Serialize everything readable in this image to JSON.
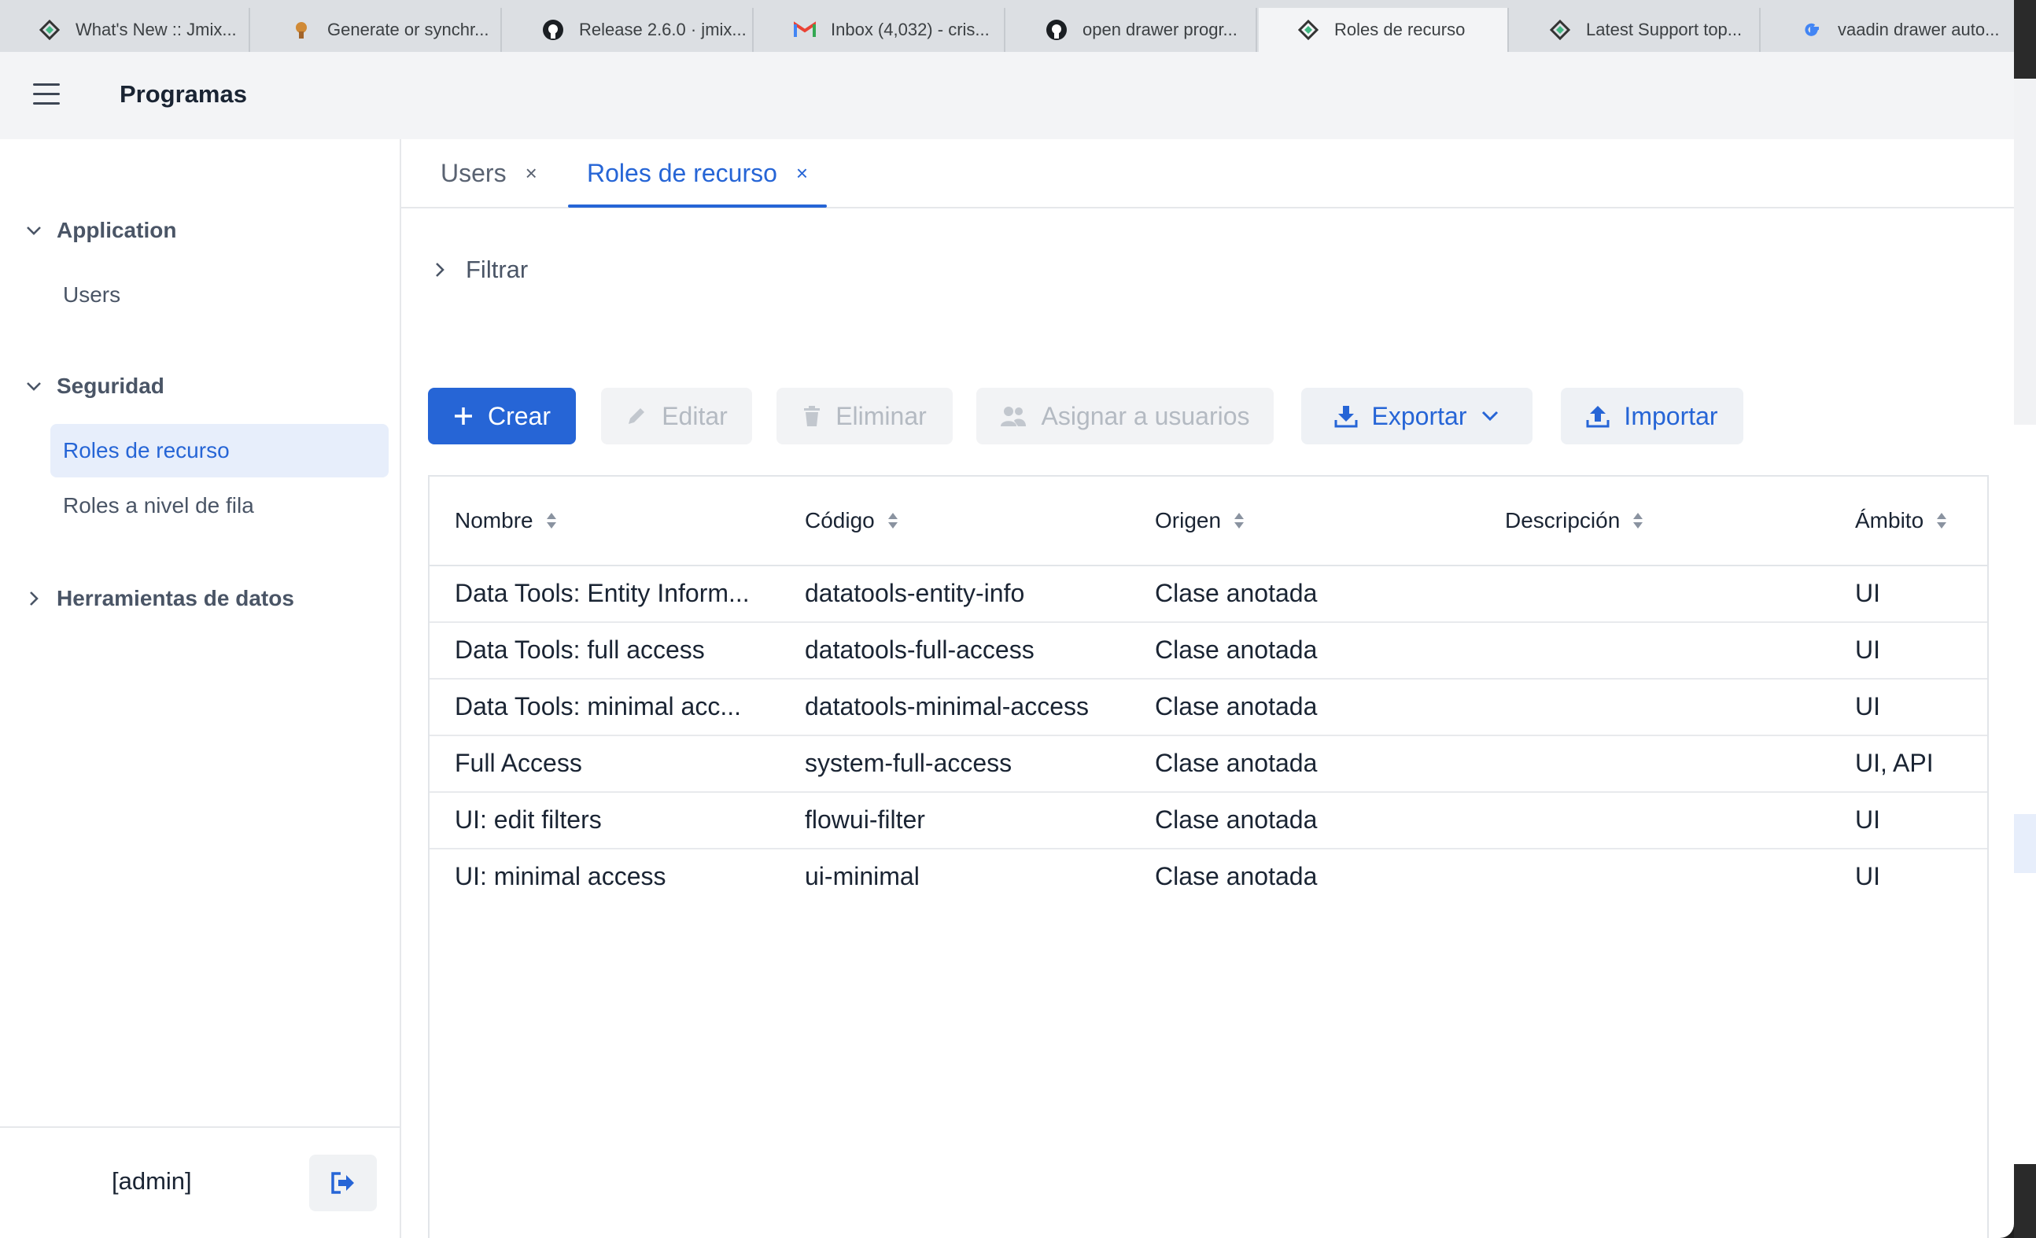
{
  "browser_tabs": [
    {
      "label": "What's New :: Jmix...",
      "icon": "jmix-icon"
    },
    {
      "label": "Generate or synchr...",
      "icon": "tool-icon"
    },
    {
      "label": "Release 2.6.0 · jmix...",
      "icon": "github-icon"
    },
    {
      "label": "Inbox (4,032) - cris...",
      "icon": "gmail-icon"
    },
    {
      "label": "open drawer progr...",
      "icon": "github-icon"
    },
    {
      "label": "Roles de recurso",
      "icon": "jmix-icon"
    },
    {
      "label": "Latest Support top...",
      "icon": "jmix-icon"
    },
    {
      "label": "vaadin drawer auto...",
      "icon": "google-icon"
    }
  ],
  "app": {
    "title": "Programas"
  },
  "drawer": {
    "groups": [
      {
        "label": "Application",
        "items": [
          {
            "label": "Users"
          }
        ]
      },
      {
        "label": "Seguridad",
        "items": [
          {
            "label": "Roles de recurso"
          },
          {
            "label": "Roles a nivel de fila"
          }
        ]
      },
      {
        "label": "Herramientas de datos",
        "items": []
      }
    ],
    "user": "[admin]"
  },
  "view_tabs": [
    {
      "label": "Users",
      "close": "×"
    },
    {
      "label": "Roles de recurso",
      "close": "×"
    }
  ],
  "filter": {
    "label": "Filtrar"
  },
  "toolbar": {
    "create": "Crear",
    "edit": "Editar",
    "delete": "Eliminar",
    "assign": "Asignar a usuarios",
    "export": "Exportar",
    "import": "Importar"
  },
  "grid": {
    "columns": [
      "Nombre",
      "Código",
      "Origen",
      "Descripción",
      "Ámbito"
    ],
    "rows": [
      [
        "Data Tools: Entity Inform...",
        "datatools-entity-info",
        "Clase anotada",
        "",
        "UI"
      ],
      [
        "Data Tools: full access",
        "datatools-full-access",
        "Clase anotada",
        "",
        "UI"
      ],
      [
        "Data Tools: minimal acc...",
        "datatools-minimal-access",
        "Clase anotada",
        "",
        "UI"
      ],
      [
        "Full Access",
        "system-full-access",
        "Clase anotada",
        "",
        "UI, API"
      ],
      [
        "UI: edit filters",
        "flowui-filter",
        "Clase anotada",
        "",
        "UI"
      ],
      [
        "UI: minimal access",
        "ui-minimal",
        "Clase anotada",
        "",
        "UI"
      ]
    ]
  },
  "colors": {
    "accent": "#2665d6",
    "selected_bg": "#e7eefb",
    "disabled_text": "#b4bac2"
  }
}
